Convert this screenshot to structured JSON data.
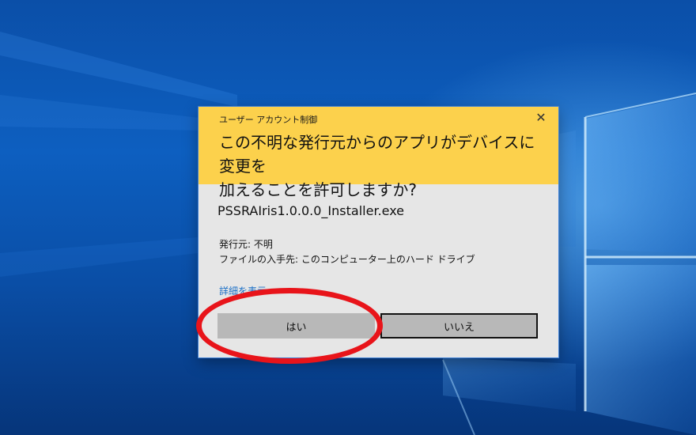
{
  "dialog": {
    "caption": "ユーザー アカウント制御",
    "close_icon": "close-icon",
    "question": "この不明な発行元からのアプリがデバイスに変更を\n加えることを許可しますか?",
    "app_name": "PSSRAIris1.0.0.0_Installer.exe",
    "publisher_line": "発行元: 不明",
    "origin_line": "ファイルの入手先: このコンピューター上のハード ドライブ",
    "details_link": "詳細を表示",
    "yes_label": "はい",
    "no_label": "いいえ",
    "header_color": "#fcd14c",
    "link_color": "#1a6fc7"
  },
  "annotation": {
    "color": "#e8141a",
    "highlights": "yes-button"
  }
}
